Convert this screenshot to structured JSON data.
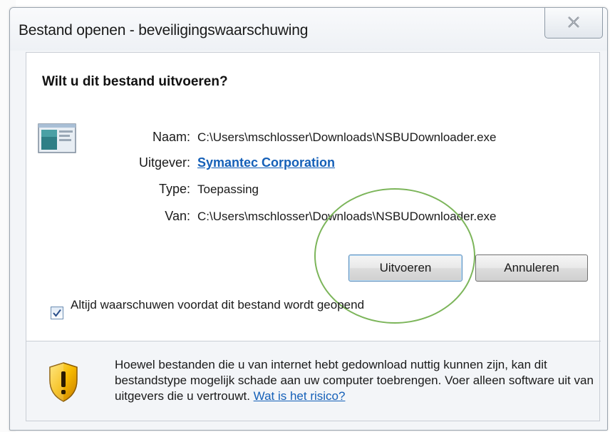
{
  "window": {
    "title": "Bestand openen - beveiligingswaarschuwing"
  },
  "dialog": {
    "question": "Wilt u dit bestand uitvoeren?",
    "fields": {
      "name_label": "Naam:",
      "name_value": "C:\\Users\\mschlosser\\Downloads\\NSBUDownloader.exe",
      "publisher_label": "Uitgever:",
      "publisher_value": "Symantec Corporation",
      "type_label": "Type:",
      "type_value": "Toepassing",
      "from_label": "Van:",
      "from_value": "C:\\Users\\mschlosser\\Downloads\\NSBUDownloader.exe"
    },
    "buttons": {
      "run": "Uitvoeren",
      "cancel": "Annuleren"
    },
    "checkbox": {
      "label": "Altijd waarschuwen voordat dit bestand wordt geopend",
      "checked": true
    },
    "warning": {
      "text": "Hoewel bestanden die u van internet hebt gedownload nuttig kunnen zijn, kan dit bestandstype mogelijk schade aan uw computer toebrengen. Voer alleen software uit van uitgevers die u vertrouwt.",
      "link": "Wat is het risico?"
    }
  },
  "colors": {
    "link": "#1560b8",
    "highlight_circle": "#7cb55a",
    "shield_yellow": "#f5b800"
  },
  "icons": {
    "close": "close-icon",
    "app": "application-icon",
    "warning": "warning-shield-icon",
    "checkmark": "checkmark-icon"
  }
}
